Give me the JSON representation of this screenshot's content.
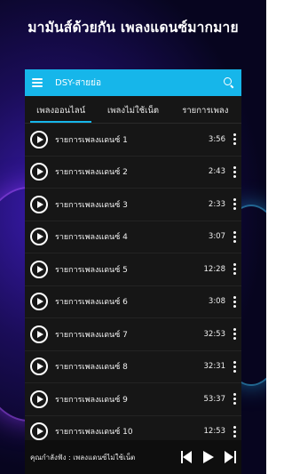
{
  "headline": "มามันส์ด้วยกัน เพลงแดนซ์มากมาย",
  "app": {
    "title": "DSY-สายย่อ"
  },
  "tabs": [
    {
      "label": "เพลงออนไลน์",
      "active": true
    },
    {
      "label": "เพลงไม่ใช้เน็ต",
      "active": false
    },
    {
      "label": "รายการเพลง",
      "active": false
    }
  ],
  "songs": [
    {
      "title": "รายการเพลงแดนซ์ 1",
      "duration": "3:56"
    },
    {
      "title": "รายการเพลงแดนซ์ 2",
      "duration": "2:43"
    },
    {
      "title": "รายการเพลงแดนซ์ 3",
      "duration": "2:33"
    },
    {
      "title": "รายการเพลงแดนซ์ 4",
      "duration": "3:07"
    },
    {
      "title": "รายการเพลงแดนซ์ 5",
      "duration": "12:28"
    },
    {
      "title": "รายการเพลงแดนซ์ 6",
      "duration": "3:08"
    },
    {
      "title": "รายการเพลงแดนซ์ 7",
      "duration": "32:53"
    },
    {
      "title": "รายการเพลงแดนซ์ 8",
      "duration": "32:31"
    },
    {
      "title": "รายการเพลงแดนซ์ 9",
      "duration": "53:37"
    },
    {
      "title": "รายการเพลงแดนซ์ 10",
      "duration": "12:53"
    }
  ],
  "player": {
    "now_playing": "คุณกำลังฟัง : เพลงแดนซ์ไม่ใช้เน็ต"
  },
  "icons": {
    "menu": "menu-icon",
    "search": "search-icon",
    "play": "play-circle-icon",
    "more": "more-vert-icon",
    "prev": "skip-previous-icon",
    "next": "skip-next-icon"
  },
  "colors": {
    "accent": "#16b6ea",
    "list_bg": "#161616",
    "text": "#ffffff"
  }
}
